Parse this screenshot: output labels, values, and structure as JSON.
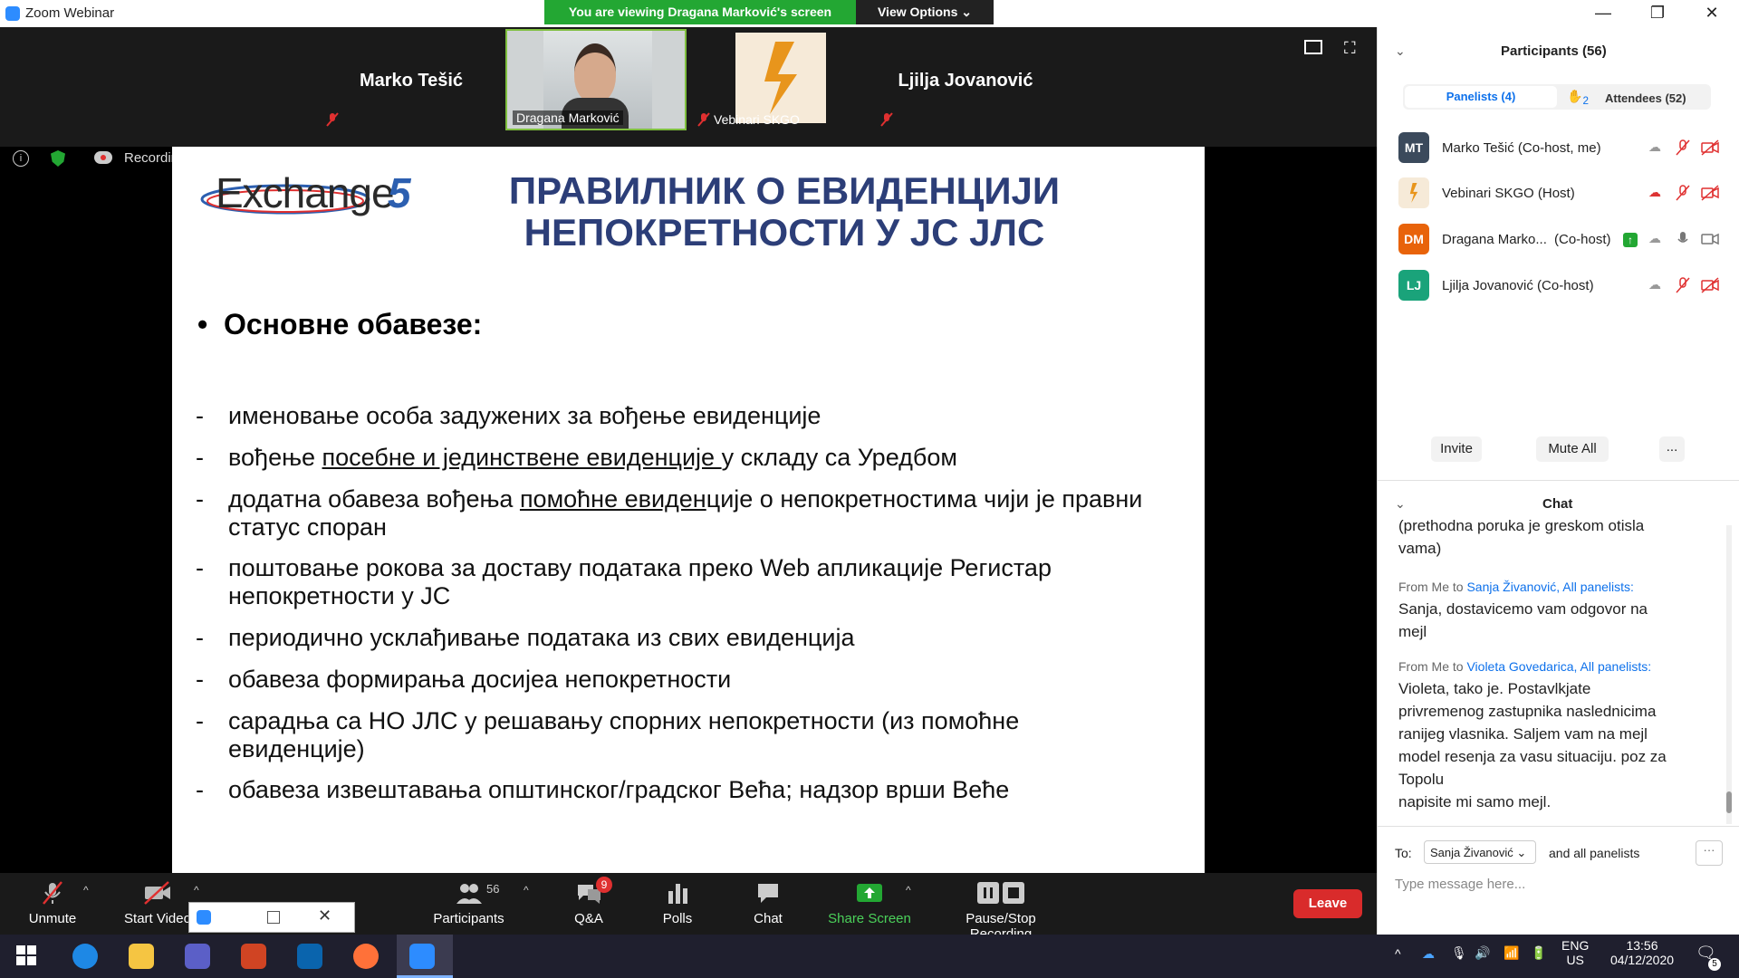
{
  "window": {
    "app_title": "Zoom Webinar",
    "viewing_banner": "You are viewing Dragana Marković's screen",
    "view_options": "View Options",
    "view_options_icon": "chevron-down-icon"
  },
  "video_tiles": [
    {
      "name": "Marko Tešić",
      "muted": true
    },
    {
      "name": "Dragana Marković",
      "muted": false,
      "has_video": true
    },
    {
      "name": "Vebinari SKGO",
      "muted": true,
      "has_logo": true
    },
    {
      "name": "Ljilja Jovanović",
      "muted": true
    }
  ],
  "recording": {
    "label": "Recording..."
  },
  "slide": {
    "logo_text": "Exchange",
    "logo_number": "5",
    "title_line1": "ПРАВИЛНИК О ЕВИДЕНЦИЈИ",
    "title_line2": "НЕПОКРЕТНОСТИ У ЈС ЈЛС",
    "heading_bullet": "•",
    "heading": "Основне обавезе:",
    "dash": "-",
    "bullets": [
      {
        "pre": "именовање особа задужених за вођење евиденције",
        "u": "",
        "post": ""
      },
      {
        "pre": "вођење ",
        "u": "посебне и јединствене евиденције ",
        "post": "у складу са Уредбом"
      },
      {
        "pre": "додатна обавеза вођења ",
        "u": "помоћне евиден",
        "post": "ције о непокретностима чији је правни статус споран"
      },
      {
        "pre": "поштовање рокова за доставу података преко Web апликације Регистар непокретности у ЈС",
        "u": "",
        "post": ""
      },
      {
        "pre": "периодично усклађивање података из свих евиденција",
        "u": "",
        "post": ""
      },
      {
        "pre": "обавеза формирања досијеа непокретности",
        "u": "",
        "post": ""
      },
      {
        "pre": "сарадња са НО ЈЛС у решавању спорних непокретности (из помоћне евиденције)",
        "u": "",
        "post": ""
      },
      {
        "pre": "обавеза извештавања општинског/градског Већа; надзор врши Веће",
        "u": "",
        "post": ""
      }
    ]
  },
  "toolbar": {
    "unmute": "Unmute",
    "start_video": "Start Video",
    "participants": "Participants",
    "participants_count": "56",
    "qa": "Q&A",
    "qa_badge": "9",
    "polls": "Polls",
    "chat": "Chat",
    "share_screen": "Share Screen",
    "pause_stop": "Pause/Stop Recording",
    "leave": "Leave",
    "leave_color": "#d92b2b",
    "share_color": "#23a733"
  },
  "panel": {
    "participants_title": "Participants (56)",
    "tab_panelists": "Panelists (4)",
    "tab_attendees": "Attendees (52)",
    "attendees_hand_count": "2",
    "participants": [
      {
        "initials": "MT",
        "name": "Marko Tešić (Co-host, me)",
        "color": "#3b4a5c"
      },
      {
        "initials": "",
        "name": "Vebinari SKGO (Host)",
        "color": "#ffffff"
      },
      {
        "initials": "DM",
        "name": "Dragana Marko...",
        "role": "(Co-host)",
        "color": "#e8630a"
      },
      {
        "initials": "LJ",
        "name": "Ljilja Jovanović (Co-host)",
        "color": "#1aa37a"
      }
    ],
    "invite": "Invite",
    "mute_all": "Mute All",
    "more": "...",
    "chat_title": "Chat",
    "chat_partial": "(prethodna poruka je greskom otisla",
    "chat_partial2": "vama)",
    "messages": [
      {
        "from": "From Me to ",
        "to": "Sanja Živanović, All panelists:",
        "lines": [
          "Sanja, dostavicemo vam odgovor na",
          "mejl"
        ]
      },
      {
        "from": "From Me to ",
        "to": "Violeta Govedarica, All panelists:",
        "lines": [
          "Violeta, tako je. Postavlkjate",
          "privremenog zastupnika naslednicima",
          "ranijeg vlasnika. Saljem vam na mejl",
          "model resenja za vasu situaciju. poz za",
          "Topolu",
          "napisite mi samo mejl."
        ]
      }
    ],
    "to_label": "To:",
    "to_select": "Sanja Živanović",
    "and_all": "and all panelists",
    "input_placeholder": "Type message here..."
  },
  "taskbar": {
    "lang1": "ENG",
    "lang2": "US",
    "time": "13:56",
    "date": "04/12/2020",
    "notif_count": "5"
  }
}
